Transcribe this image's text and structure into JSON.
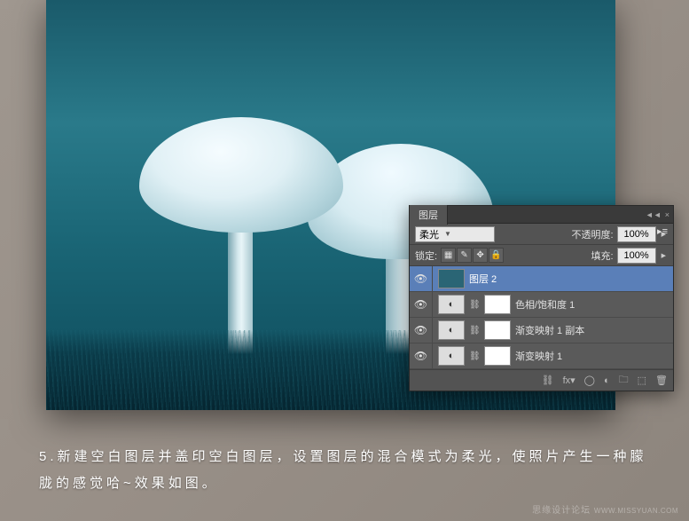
{
  "panel": {
    "tab_label": "图层",
    "blend_mode": "柔光",
    "opacity_label": "不透明度:",
    "opacity_value": "100%",
    "lock_label": "锁定:",
    "fill_label": "填充:",
    "fill_value": "100%",
    "layers": [
      {
        "name": "图层 2",
        "type": "image",
        "selected": true
      },
      {
        "name": "色相/饱和度 1",
        "type": "adjustment"
      },
      {
        "name": "渐变映射 1 副本",
        "type": "adjustment"
      },
      {
        "name": "渐变映射 1",
        "type": "adjustment"
      }
    ],
    "footer_link": "fx"
  },
  "caption": {
    "text": "5.新建空白图层并盖印空白图层，设置图层的混合模式为柔光，使照片产生一种朦胧的感觉哈~效果如图。"
  },
  "watermark": {
    "site": "思缘设计论坛",
    "url": "WWW.MISSYUAN.COM"
  }
}
